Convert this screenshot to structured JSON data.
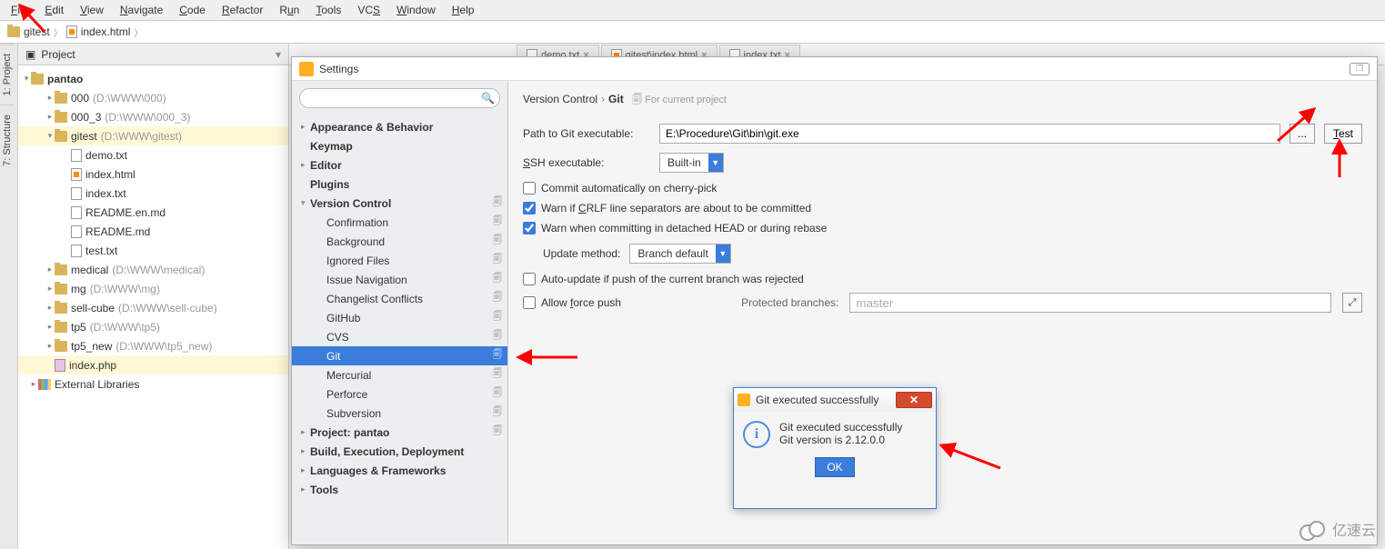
{
  "menu": {
    "items": [
      "File",
      "Edit",
      "View",
      "Navigate",
      "Code",
      "Refactor",
      "Run",
      "Tools",
      "VCS",
      "Window",
      "Help"
    ]
  },
  "breadcrumb": {
    "project": "gitest",
    "file": "index.html"
  },
  "left_edge": {
    "tabs": [
      "1: Project",
      "7: Structure"
    ]
  },
  "project_panel": {
    "header": "Project",
    "root": "pantao",
    "items": [
      {
        "indent": 1,
        "arrow": "▸",
        "icon": "folder",
        "label": "000",
        "hint": "(D:\\WWW\\000)"
      },
      {
        "indent": 1,
        "arrow": "▸",
        "icon": "folder",
        "label": "000_3",
        "hint": "(D:\\WWW\\000_3)"
      },
      {
        "indent": 1,
        "arrow": "▾",
        "icon": "folder",
        "label": "gitest",
        "hint": "(D:\\WWW\\gitest)",
        "sel": true
      },
      {
        "indent": 2,
        "arrow": "",
        "icon": "txt",
        "label": "demo.txt"
      },
      {
        "indent": 2,
        "arrow": "",
        "icon": "html",
        "label": "index.html"
      },
      {
        "indent": 2,
        "arrow": "",
        "icon": "txt",
        "label": "index.txt"
      },
      {
        "indent": 2,
        "arrow": "",
        "icon": "txt",
        "label": "README.en.md"
      },
      {
        "indent": 2,
        "arrow": "",
        "icon": "txt",
        "label": "README.md"
      },
      {
        "indent": 2,
        "arrow": "",
        "icon": "txt",
        "label": "test.txt"
      },
      {
        "indent": 1,
        "arrow": "▸",
        "icon": "folder",
        "label": "medical",
        "hint": "(D:\\WWW\\medical)"
      },
      {
        "indent": 1,
        "arrow": "▸",
        "icon": "folder",
        "label": "mg",
        "hint": "(D:\\WWW\\mg)"
      },
      {
        "indent": 1,
        "arrow": "▸",
        "icon": "folder",
        "label": "sell-cube",
        "hint": "(D:\\WWW\\sell-cube)"
      },
      {
        "indent": 1,
        "arrow": "▸",
        "icon": "folder",
        "label": "tp5",
        "hint": "(D:\\WWW\\tp5)"
      },
      {
        "indent": 1,
        "arrow": "▸",
        "icon": "folder",
        "label": "tp5_new",
        "hint": "(D:\\WWW\\tp5_new)"
      },
      {
        "indent": 1,
        "arrow": "",
        "icon": "php",
        "label": "index.php",
        "sel": true
      },
      {
        "indent": 0,
        "arrow": "▸",
        "icon": "lib",
        "label": "External Libraries"
      }
    ]
  },
  "editor_tabs": [
    {
      "label": "demo.txt"
    },
    {
      "label": "gitest\\index.html"
    },
    {
      "label": "index.txt"
    }
  ],
  "dialog": {
    "title": "Settings",
    "search_placeholder": "",
    "crumb": {
      "a": "Version Control",
      "b": "Git",
      "scope": "For current project"
    },
    "tree": [
      {
        "arrow": "▸",
        "label": "Appearance & Behavior",
        "bold": true
      },
      {
        "arrow": "",
        "label": "Keymap",
        "bold": true
      },
      {
        "arrow": "▸",
        "label": "Editor",
        "bold": true
      },
      {
        "arrow": "",
        "label": "Plugins",
        "bold": true
      },
      {
        "arrow": "▾",
        "label": "Version Control",
        "bold": true,
        "copy": true
      },
      {
        "arrow": "",
        "indent": "indent1",
        "label": "Confirmation",
        "copy": true
      },
      {
        "arrow": "",
        "indent": "indent1",
        "label": "Background",
        "copy": true
      },
      {
        "arrow": "",
        "indent": "indent1",
        "label": "Ignored Files",
        "copy": true
      },
      {
        "arrow": "",
        "indent": "indent1",
        "label": "Issue Navigation",
        "copy": true
      },
      {
        "arrow": "",
        "indent": "indent1",
        "label": "Changelist Conflicts",
        "copy": true
      },
      {
        "arrow": "",
        "indent": "indent1",
        "label": "GitHub",
        "copy": true
      },
      {
        "arrow": "",
        "indent": "indent1",
        "label": "CVS",
        "copy": true
      },
      {
        "arrow": "",
        "indent": "indent1",
        "label": "Git",
        "copy": true,
        "sel": true
      },
      {
        "arrow": "",
        "indent": "indent1",
        "label": "Mercurial",
        "copy": true
      },
      {
        "arrow": "",
        "indent": "indent1",
        "label": "Perforce",
        "copy": true
      },
      {
        "arrow": "",
        "indent": "indent1",
        "label": "Subversion",
        "copy": true
      },
      {
        "arrow": "▸",
        "label": "Project: pantao",
        "bold": true,
        "copy": true
      },
      {
        "arrow": "▸",
        "label": "Build, Execution, Deployment",
        "bold": true
      },
      {
        "arrow": "▸",
        "label": "Languages & Frameworks",
        "bold": true
      },
      {
        "arrow": "▸",
        "label": "Tools",
        "bold": true
      }
    ],
    "form": {
      "path_label": "Path to Git executable:",
      "path_value": "E:\\Procedure\\Git\\bin\\git.exe",
      "browse": "...",
      "test": "Test",
      "ssh_label": "SSH executable:",
      "ssh_value": "Built-in",
      "chk_cherry": "Commit automatically on cherry-pick",
      "chk_crlf": "Warn if CRLF line separators are about to be committed",
      "chk_detached": "Warn when committing in detached HEAD or during rebase",
      "update_label": "Update method:",
      "update_value": "Branch default",
      "chk_auto": "Auto-update if push of the current branch was rejected",
      "chk_force": "Allow force push",
      "protected_label": "Protected branches:",
      "protected_value": "master"
    }
  },
  "msgbox": {
    "title": "Git executed successfully",
    "line1": "Git executed successfully",
    "line2": "Git version is 2.12.0.0",
    "ok": "OK"
  },
  "watermark": "亿速云"
}
